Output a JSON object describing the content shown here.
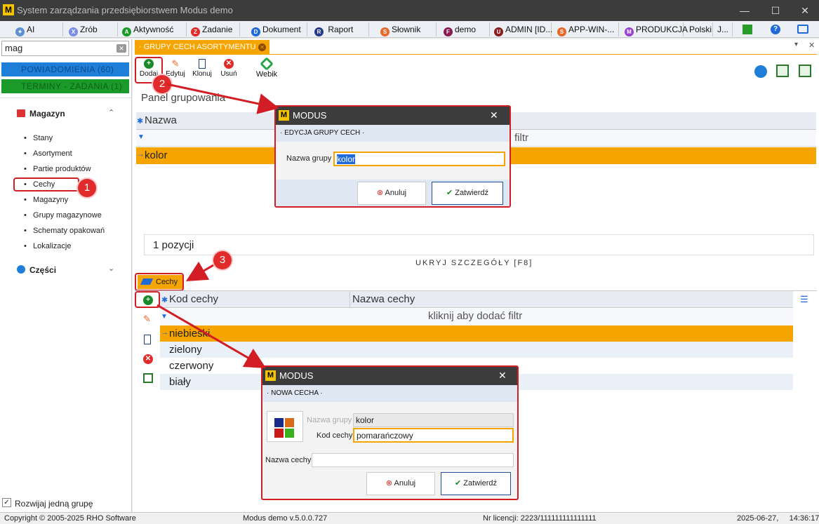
{
  "window": {
    "title": "System zarządzania przedsiębiorstwem Modus demo",
    "logo": "M"
  },
  "toolbar": {
    "items": [
      "AI",
      "Zrób",
      "Aktywność",
      "Zadanie",
      "Dokument",
      "Raport",
      "Słownik",
      "demo",
      "ADMIN [ID...",
      "APP-WIN-...",
      "PRODUKCJA",
      "Polski",
      "J..."
    ]
  },
  "sidebar": {
    "search_value": "mag",
    "notif1": "POWIADOMIENIA (60)",
    "notif2": "TERMINY - ZADANIA (1)",
    "group1": "Magazyn",
    "items": [
      "Stany",
      "Asortyment",
      "Partie produktów",
      "Cechy",
      "Magazyny",
      "Grupy magazynowe",
      "Schematy opakowań",
      "Lokalizacje"
    ],
    "group2": "Części",
    "footer_checkbox": "Rozwijaj jedną grupę"
  },
  "tab": {
    "label": "· GRUPY CECH ASORTYMENTU ·"
  },
  "actions": {
    "add": "Dodaj",
    "edit": "Edytuj",
    "clone": "Klonuj",
    "delete": "Usuń",
    "webik": "Webik"
  },
  "upper": {
    "panel": "Panel grupowania",
    "col": "Nazwa",
    "filter": "filtr",
    "rows": [
      "kolor"
    ],
    "count": "1 pozycji",
    "hide": "UKRYJ SZCZEGÓŁY [F8]"
  },
  "lower": {
    "tab": "Cechy",
    "col1": "Kod cechy",
    "col2": "Nazwa cechy",
    "filter": "kliknij aby dodać filtr",
    "rows": [
      "niebieski",
      "zielony",
      "czerwony",
      "biały"
    ]
  },
  "dialog1": {
    "title": "MODUS",
    "subtitle": "· EDYCJA GRUPY CECH ·",
    "label": "Nazwa grupy",
    "value": "kolor",
    "cancel": "Anuluj",
    "ok": "Zatwierdź"
  },
  "dialog2": {
    "title": "MODUS",
    "subtitle": "· NOWA CECHA ·",
    "label_group": "Nazwa grupy",
    "value_group": "kolor",
    "label_code": "Kod cechy",
    "value_code": "pomarańczowy",
    "label_name": "Nazwa cechy",
    "value_name": "",
    "cancel": "Anuluj",
    "ok": "Zatwierdź"
  },
  "badges": [
    "1",
    "2",
    "3"
  ],
  "status": {
    "copyright": "Copyright © 2005-2025 RHO Software",
    "version": "Modus demo v.5.0.0.727",
    "license": "Nr licencji: 2223/111111111111111",
    "datetime": "2025-06-27,     14:36:17"
  },
  "colors": {
    "accent": "#f5a400",
    "highlight": "#d31d25",
    "notif1": "#1f7fd8",
    "notif2": "#1a9a28"
  }
}
